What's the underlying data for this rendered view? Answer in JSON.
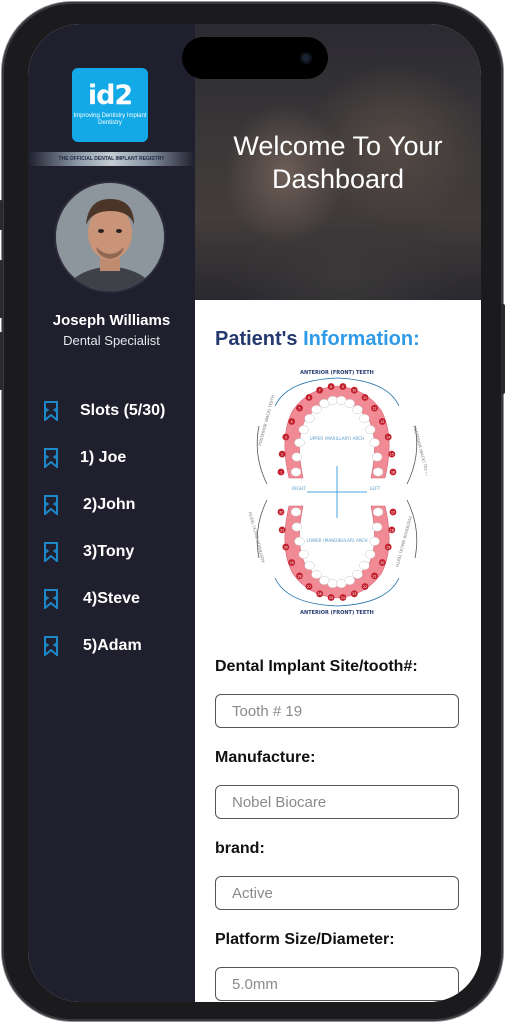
{
  "brand": {
    "logo_text": "id2",
    "logo_tagline": "Improving Dentistry Implant Dentistry",
    "registry_tag": "THE OFFICIAL DENTAL IMPLANT REGISTRY",
    "color": "#13a9e6"
  },
  "user": {
    "name": "Joseph Williams",
    "role": "Dental Specialist"
  },
  "slots": [
    {
      "label": "Slots (5/30)"
    },
    {
      "label": "1) Joe"
    },
    {
      "label": "2)John"
    },
    {
      "label": "3)Tony"
    },
    {
      "label": "4)Steve"
    },
    {
      "label": "5)Adam"
    }
  ],
  "hero": {
    "title": "Welcome To Your Dashboard"
  },
  "patient": {
    "title_part1": "Patient's",
    "title_part2": "Information:"
  },
  "dental_chart": {
    "top_label": "ANTERIOR (FRONT) TEETH",
    "bottom_label": "ANTERIOR (FRONT) TEETH",
    "upper_arch": "UPPER (MAXILLARY) ARCH",
    "lower_arch": "LOWER (MANDIBULAR) ARCH",
    "right": "RIGHT",
    "left": "LEFT",
    "posterior": "POSTERIOR (BACK) TEETH",
    "upper_numbers": [
      "1",
      "2",
      "3",
      "4",
      "5",
      "6",
      "7",
      "8",
      "9",
      "10",
      "11",
      "12",
      "13",
      "14",
      "15",
      "16"
    ],
    "lower_numbers": [
      "17",
      "18",
      "19",
      "20",
      "21",
      "22",
      "23",
      "24",
      "25",
      "26",
      "27",
      "28",
      "29",
      "30",
      "31",
      "32"
    ]
  },
  "form": {
    "site_label": "Dental Implant Site/tooth#:",
    "site_placeholder": "Tooth # 19",
    "manufacture_label": "Manufacture:",
    "manufacture_placeholder": "Nobel Biocare",
    "brand_label": "brand:",
    "brand_placeholder": "Active",
    "platform_label": "Platform Size/Diameter:",
    "platform_placeholder": "5.0mm"
  },
  "colors": {
    "sidebar_bg": "#1f1f2e",
    "accent_blue": "#2f9be8",
    "title_navy": "#243a6e",
    "slot_icon": "#1e88c8"
  }
}
